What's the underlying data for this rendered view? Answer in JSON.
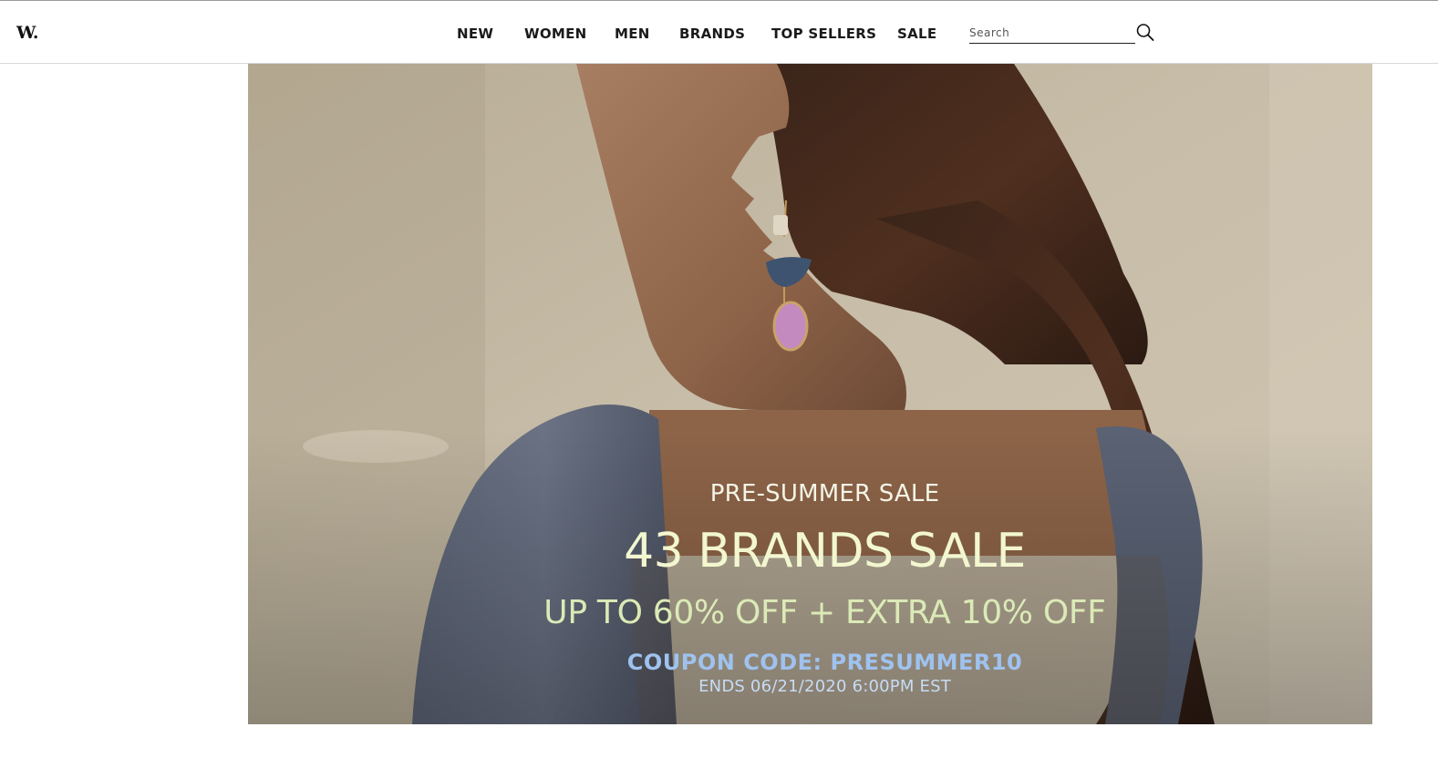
{
  "header": {
    "logo": "W.",
    "nav": [
      {
        "label": "NEW"
      },
      {
        "label": "WOMEN"
      },
      {
        "label": "MEN"
      },
      {
        "label": "BRANDS"
      },
      {
        "label": "TOP SELLERS"
      },
      {
        "label": "SALE"
      }
    ],
    "search": {
      "placeholder": "Search",
      "value": "",
      "icon": "search-icon"
    }
  },
  "hero": {
    "kicker": "PRE-SUMMER SALE",
    "headline": "43 BRANDS SALE",
    "offer": "UP TO 60% OFF + EXTRA 10% OFF",
    "coupon": "COUPON CODE: PRESUMMER10",
    "ends": "ENDS 06/21/2020  6:00PM EST"
  },
  "colors": {
    "headline": "#f2f7cf",
    "offer": "#dbeab6",
    "coupon": "#9fc2ee",
    "ends": "#c7dcf4",
    "nav_text": "#1a1a1a"
  }
}
